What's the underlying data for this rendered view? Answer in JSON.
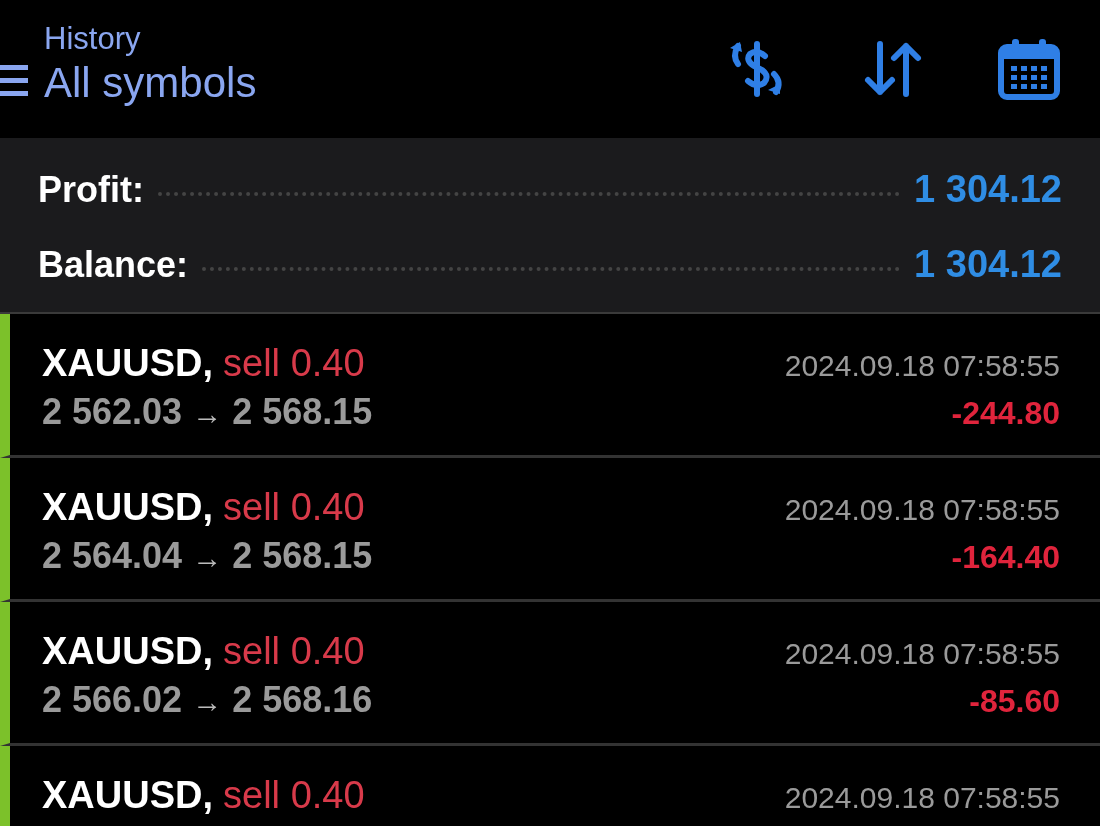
{
  "header": {
    "subtitle": "History",
    "title": "All symbols"
  },
  "summary": [
    {
      "label": "Profit:",
      "value": "1 304.12"
    },
    {
      "label": "Balance:",
      "value": "1 304.12"
    }
  ],
  "deals": [
    {
      "symbol": "XAUUSD,",
      "side": "sell",
      "volume": "0.40",
      "time": "2024.09.18 07:58:55",
      "open_price": "2 562.03",
      "arrow": "→",
      "close_price": "2 568.15",
      "profit": "-244.80"
    },
    {
      "symbol": "XAUUSD,",
      "side": "sell",
      "volume": "0.40",
      "time": "2024.09.18 07:58:55",
      "open_price": "2 564.04",
      "arrow": "→",
      "close_price": "2 568.15",
      "profit": "-164.40"
    },
    {
      "symbol": "XAUUSD,",
      "side": "sell",
      "volume": "0.40",
      "time": "2024.09.18 07:58:55",
      "open_price": "2 566.02",
      "arrow": "→",
      "close_price": "2 568.16",
      "profit": "-85.60"
    },
    {
      "symbol": "XAUUSD,",
      "side": "sell",
      "volume": "0.40",
      "time": "2024.09.18 07:58:55"
    }
  ]
}
